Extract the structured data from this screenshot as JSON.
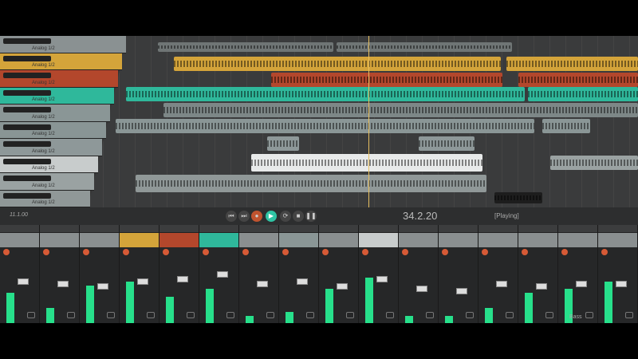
{
  "tracks": [
    {
      "name": "Analog 1/2",
      "color": "#8a9192"
    },
    {
      "name": "Analog 1/2",
      "color": "#d4a43a"
    },
    {
      "name": "Analog 1/2",
      "color": "#b3472c"
    },
    {
      "name": "Analog 1/2",
      "color": "#2fb89b"
    },
    {
      "name": "Analog 1/2",
      "color": "#8a9696"
    },
    {
      "name": "Analog 1/2",
      "color": "#899595"
    },
    {
      "name": "Analog 1/2",
      "color": "#8e9899"
    },
    {
      "name": "Analog 1/2",
      "color": "#c8cccc"
    },
    {
      "name": "Analog 1/2",
      "color": "#9aa2a2"
    },
    {
      "name": "Analog 1/2",
      "color": "#909898"
    }
  ],
  "transport": {
    "time_left": "11.1.00",
    "position": "34.2.20",
    "status": "[Playing]",
    "buttons": [
      "skip-start",
      "skip-end",
      "record",
      "play",
      "repeat",
      "stop",
      "pause"
    ]
  },
  "mixer": {
    "strip_colors": [
      "#8a8f90",
      "#8a8f90",
      "#8a8f90",
      "#d4a43a",
      "#b3472c",
      "#2fb89b",
      "#8a8f90",
      "#8a9696",
      "#8a8f90",
      "#c8cccc",
      "#8a8f90",
      "#8a8f90",
      "#8a8f90",
      "#8a8f90",
      "#8a8f90",
      "#8a8f90"
    ],
    "levels": [
      0.4,
      0.2,
      0.5,
      0.55,
      0.35,
      0.45,
      0.1,
      0.15,
      0.45,
      0.6,
      0.1,
      0.1,
      0.2,
      0.4,
      0.45,
      0.55
    ],
    "faders": [
      0.55,
      0.5,
      0.45,
      0.55,
      0.6,
      0.7,
      0.5,
      0.55,
      0.45,
      0.6,
      0.4,
      0.35,
      0.5,
      0.45,
      0.5,
      0.5
    ],
    "last_strip_name": "Bass"
  }
}
